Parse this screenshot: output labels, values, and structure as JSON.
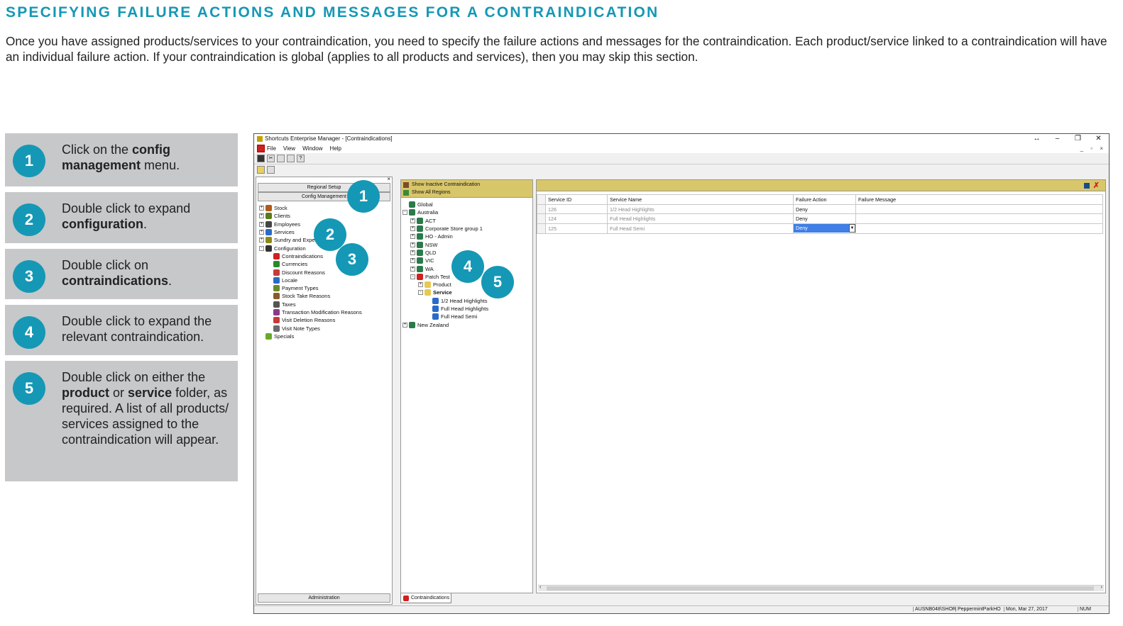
{
  "heading": "SPECIFYING FAILURE ACTIONS AND MESSAGES FOR A CONTRAINDICATION",
  "intro": "Once you have assigned products/services to your contraindication, you need to specify the failure actions and messages for the contraindication. Each product/service linked to a contraindication will have an individual failure action. If your contraindication is global (applies to all products and services), then you may skip this section.",
  "steps": [
    {
      "num": "1",
      "pre": "Click on the ",
      "bold": "config management",
      "post": " menu."
    },
    {
      "num": "2",
      "pre": "Double click to expand ",
      "bold": "configuration",
      "post": "."
    },
    {
      "num": "3",
      "pre": "Double click on ",
      "bold": "contraindications",
      "post": "."
    },
    {
      "num": "4",
      "pre": "Double click to expand the relevant contraindication.",
      "bold": "",
      "post": ""
    },
    {
      "num": "5",
      "pre": "Double click on either the ",
      "bold": "product",
      "mid": " or ",
      "bold2": "service",
      "post": " folder, as required. A list of all products/ services assigned to the contraindication will appear."
    }
  ],
  "window": {
    "title": "Shortcuts Enterprise Manager - [Contraindications]",
    "menu": [
      "File",
      "View",
      "Window",
      "Help"
    ],
    "nav": {
      "regional_setup": "Regional Setup",
      "config_management": "Config Management",
      "administration": "Administration",
      "tree": [
        {
          "label": "Stock",
          "level": 0,
          "pm": "+",
          "color": "#b05a1a"
        },
        {
          "label": "Clients",
          "level": 0,
          "pm": "+",
          "color": "#5a7a1a"
        },
        {
          "label": "Employees",
          "level": 0,
          "pm": "+",
          "color": "#444"
        },
        {
          "label": "Services",
          "level": 0,
          "pm": "+",
          "color": "#2a6ac8"
        },
        {
          "label": "Sundry and Expen",
          "level": 0,
          "pm": "+",
          "color": "#8a8a1a"
        },
        {
          "label": "Configuration",
          "level": 0,
          "pm": "-",
          "color": "#333"
        },
        {
          "label": "Contraindications",
          "level": 1,
          "pm": "",
          "color": "#d02020"
        },
        {
          "label": "Currencies",
          "level": 1,
          "pm": "",
          "color": "#2a8a2a"
        },
        {
          "label": "Discount Reasons",
          "level": 1,
          "pm": "",
          "color": "#c83a3a"
        },
        {
          "label": "Locale",
          "level": 1,
          "pm": "",
          "color": "#2a6ac8"
        },
        {
          "label": "Payment Types",
          "level": 1,
          "pm": "",
          "color": "#6a8a2a"
        },
        {
          "label": "Stock Take Reasons",
          "level": 1,
          "pm": "",
          "color": "#8a5a2a"
        },
        {
          "label": "Taxes",
          "level": 1,
          "pm": "",
          "color": "#555"
        },
        {
          "label": "Transaction Modification Reasons",
          "level": 1,
          "pm": "",
          "color": "#8a3a8a"
        },
        {
          "label": "Visit Deletion Reasons",
          "level": 1,
          "pm": "",
          "color": "#c83a3a"
        },
        {
          "label": "Visit Note Types",
          "level": 1,
          "pm": "",
          "color": "#6a6a6a"
        },
        {
          "label": "Specials",
          "level": 0,
          "pm": "",
          "color": "#6aa82a"
        }
      ]
    },
    "mid": {
      "show_inactive": "Show Inactive Contraindication",
      "show_all_regions": "Show All Regions",
      "tab": "Contraindications",
      "tree": [
        {
          "label": "Global",
          "level": 0,
          "pm": "",
          "color": "#2a7a4a",
          "bold": false
        },
        {
          "label": "Australia",
          "level": 0,
          "pm": "-",
          "color": "#2a7a4a",
          "bold": false
        },
        {
          "label": "ACT",
          "level": 1,
          "pm": "+",
          "color": "#2a7a4a",
          "bold": false
        },
        {
          "label": "Corporate Store group 1",
          "level": 1,
          "pm": "+",
          "color": "#2a7a4a",
          "bold": false
        },
        {
          "label": "HO - Admin",
          "level": 1,
          "pm": "+",
          "color": "#2a7a4a",
          "bold": false
        },
        {
          "label": "NSW",
          "level": 1,
          "pm": "+",
          "color": "#2a7a4a",
          "bold": false
        },
        {
          "label": "QLD",
          "level": 1,
          "pm": "+",
          "color": "#2a7a4a",
          "bold": false
        },
        {
          "label": "VIC",
          "level": 1,
          "pm": "+",
          "color": "#2a7a4a",
          "bold": false
        },
        {
          "label": "WA",
          "level": 1,
          "pm": "+",
          "color": "#2a7a4a",
          "bold": false
        },
        {
          "label": "Patch Test",
          "level": 1,
          "pm": "-",
          "color": "#d02020",
          "bold": false
        },
        {
          "label": "Product",
          "level": 2,
          "pm": "+",
          "color": "#e8c850",
          "bold": false
        },
        {
          "label": "Service",
          "level": 2,
          "pm": "-",
          "color": "#e8c850",
          "bold": true
        },
        {
          "label": "1/2 Head Highlights",
          "level": 3,
          "pm": "",
          "color": "#2a6ac8",
          "bold": false
        },
        {
          "label": "Full Head Highlights",
          "level": 3,
          "pm": "",
          "color": "#2a6ac8",
          "bold": false
        },
        {
          "label": "Full Head Semi",
          "level": 3,
          "pm": "",
          "color": "#2a6ac8",
          "bold": false
        },
        {
          "label": "New Zealand",
          "level": 0,
          "pm": "+",
          "color": "#2a7a4a",
          "bold": false
        }
      ]
    },
    "grid": {
      "columns": [
        "Service ID",
        "Service Name",
        "Failure Action",
        "Failure Message"
      ],
      "rows": [
        {
          "id": "126",
          "name": "1/2 Head Highlights",
          "action": "Deny",
          "message": ""
        },
        {
          "id": "124",
          "name": "Full Head Highlights",
          "action": "Deny",
          "message": ""
        },
        {
          "id": "125",
          "name": "Full Head Semi",
          "action": "Deny",
          "message": ""
        }
      ]
    },
    "status": {
      "user": "AUSNB048\\SHOR",
      "location": "PeppermintParkHO",
      "date": "Mon, Mar 27, 2017",
      "num": "NUM"
    }
  },
  "callouts": [
    "1",
    "2",
    "3",
    "4",
    "5"
  ]
}
